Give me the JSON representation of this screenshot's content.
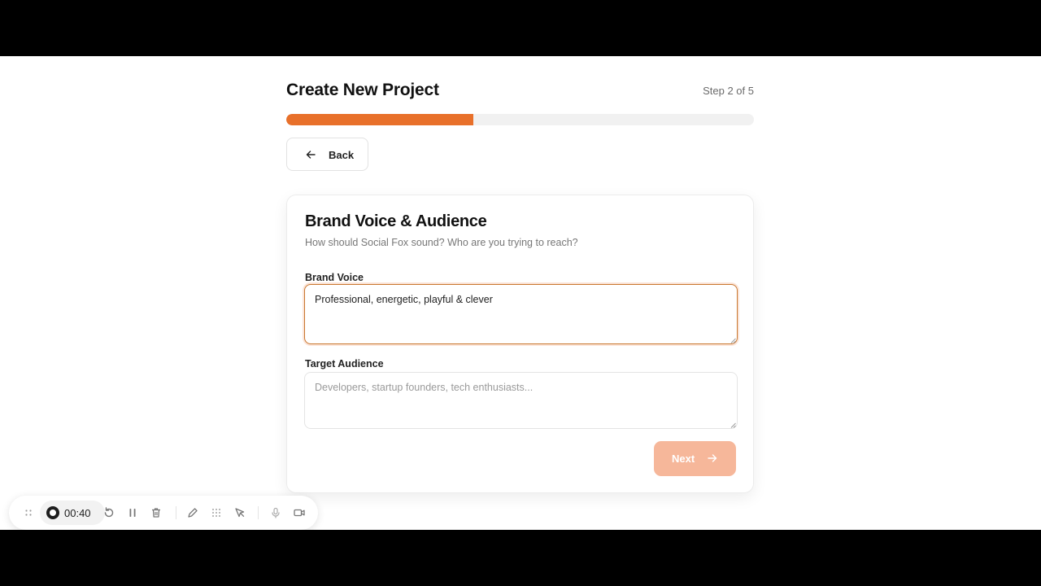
{
  "wizard": {
    "title": "Create New Project",
    "step_text": "Step 2 of 5",
    "progress": {
      "current_step": 2,
      "total_steps": 5,
      "fill_fraction": 0.4,
      "color": "#e8702a"
    },
    "back_label": "Back"
  },
  "card": {
    "title": "Brand Voice & Audience",
    "subtitle": "How should Social Fox sound? Who are you trying to reach?",
    "brand_voice": {
      "label": "Brand Voice",
      "value": "Professional, energetic, playful & clever",
      "placeholder": ""
    },
    "target_audience": {
      "label": "Target Audience",
      "value": "",
      "placeholder": "Developers, startup founders, tech enthusiasts..."
    },
    "next_label": "Next",
    "next_color": "#f6b79a"
  },
  "recorder": {
    "timer": "00:40",
    "icons": [
      "drag-handle-icon",
      "record-icon",
      "restart-icon",
      "pause-icon",
      "trash-icon",
      "pen-icon",
      "grid-icon",
      "pointer-icon",
      "microphone-icon",
      "camera-icon"
    ]
  }
}
